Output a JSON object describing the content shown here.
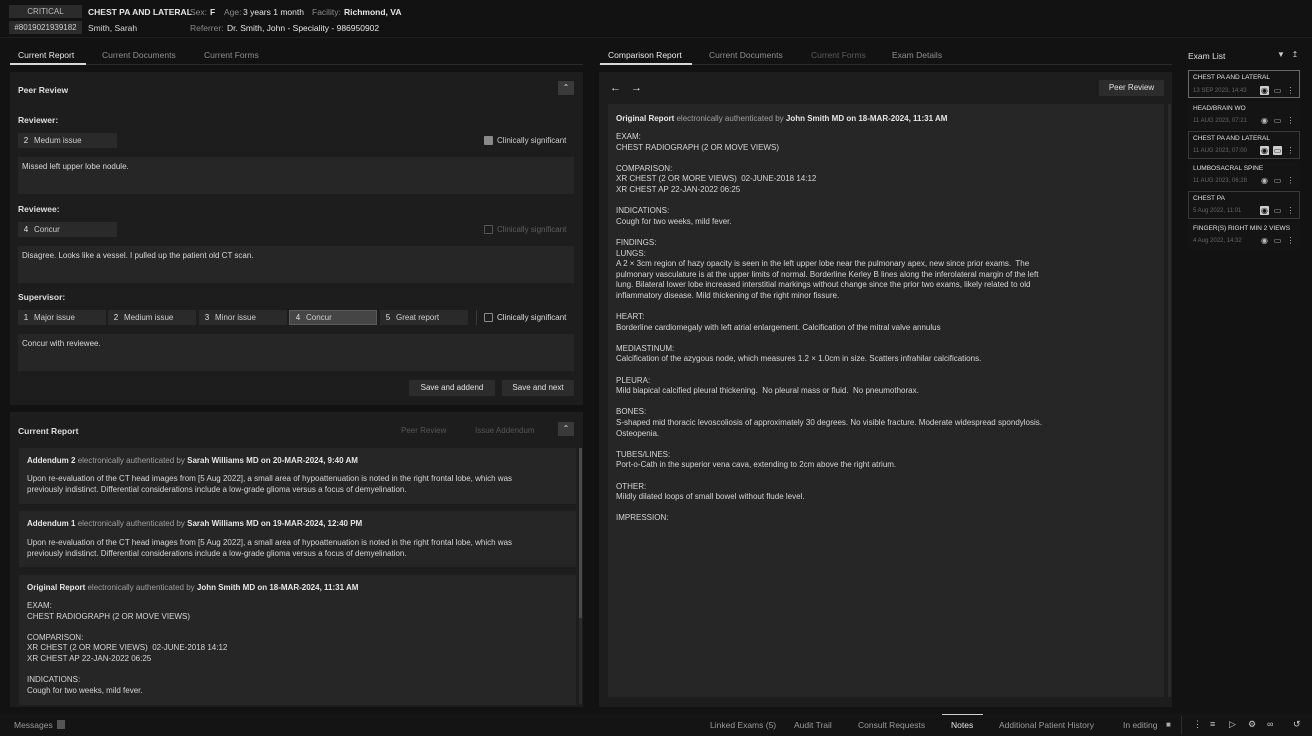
{
  "header": {
    "status": "CRITICAL",
    "exam_title": "CHEST PA AND LATERAL",
    "sex_label": "Sex:",
    "sex": "F",
    "age_label": "Age:",
    "age": "3 years 1 month",
    "facility_label": "Facility:",
    "facility": "Richmond, VA",
    "mrn": "#8019021939182",
    "patient_name": "Smith, Sarah",
    "referrer_label": "Referrer:",
    "referrer": "Dr. Smith, John - Speciality - 986950902"
  },
  "left_tabs": [
    "Current Report",
    "Current Documents",
    "Current Forms"
  ],
  "peer_review": {
    "title": "Peer Review",
    "collapse_icon": "chevron-up",
    "reviewer_label": "Reviewer:",
    "reviewer_score_num": "2",
    "reviewer_score": "Medum issue",
    "reviewer_sig_label": "Clinically significant",
    "reviewer_sig_checked": true,
    "reviewer_comment": "Missed left upper lobe nodule.",
    "reviewee_label": "Reviewee:",
    "reviewee_score_num": "4",
    "reviewee_score": "Concur",
    "reviewee_sig_label": "Clinically significant",
    "reviewee_comment": "Disagree. Looks like a vessel. I pulled up the patient old CT scan.",
    "supervisor_label": "Supervisor:",
    "options": [
      {
        "num": "1",
        "label": "Major issue"
      },
      {
        "num": "2",
        "label": "Medium issue"
      },
      {
        "num": "3",
        "label": "Minor issue"
      },
      {
        "num": "4",
        "label": "Concur"
      },
      {
        "num": "5",
        "label": "Great report"
      }
    ],
    "selected_option": "4",
    "supervisor_sig_label": "Clinically significant",
    "supervisor_comment": "Concur with reviewee.",
    "save_addend": "Save and addend",
    "save_next": "Save and next"
  },
  "current_report": {
    "title": "Current Report",
    "peer_review_btn": "Peer Review",
    "issue_addendum_btn": "Issue Addendum",
    "addenda": [
      {
        "title": "Addendum 2",
        "auth_text": "electronically authenticated by",
        "author_date": "Sarah Williams MD on 20-MAR-2024, 9:40 AM",
        "body": "Upon re-evaluation of the CT head images from [5 Aug 2022], a small area of hypoattenuation is noted in the right frontal lobe, which was\npreviously indistinct. Differential considerations include a low-grade glioma versus a focus of demyelination."
      },
      {
        "title": "Addendum 1",
        "auth_text": "electronically authenticated by",
        "author_date": "Sarah Williams MD on 19-MAR-2024, 12:40 PM",
        "body": "Upon re-evaluation of the CT head images from [5 Aug 2022], a small area of hypoattenuation is noted in the right frontal lobe, which was\npreviously indistinct. Differential considerations include a low-grade glioma versus a focus of demyelination."
      }
    ],
    "original_title": "Original Report",
    "original_auth_text": "electronically authenticated by",
    "original_author_date": "John Smith MD on 18-MAR-2024, 11:31 AM",
    "original_body": "EXAM:\nCHEST RADIOGRAPH (2 OR MOVE VIEWS)\n\nCOMPARISON:\nXR CHEST (2 OR MORE VIEWS)  02-JUNE-2018 14:12\nXR CHEST AP 22-JAN-2022 06:25\n\nINDICATIONS:\nCough for two weeks, mild fever."
  },
  "right_tabs": [
    "Comparison Report",
    "Current Documents",
    "Current Forms",
    "Exam Details"
  ],
  "comparison": {
    "peer_review_btn": "Peer Review",
    "original_title": "Original Report",
    "auth_text": "electronically authenticated by",
    "author_date": "John Smith MD on 18-MAR-2024, 11:31 AM",
    "body": "EXAM:\nCHEST RADIOGRAPH (2 OR MOVE VIEWS)\n\nCOMPARISON:\nXR CHEST (2 OR MORE VIEWS)  02-JUNE-2018 14:12\nXR CHEST AP 22-JAN-2022 06:25\n\nINDICATIONS:\nCough for two weeks, mild fever.\n\nFINDINGS:\nLUNGS:\nA 2 × 3cm region of hazy opacity is seen in the left upper lobe near the pulmonary apex, new since prior exams.  The\npulmonary vasculature is at the upper limits of normal. Borderline Kerley B lines along the inferolateral margin of the left\nlung. Bilateral lower lobe increased interstitial markings without change since the prior two exams, likely related to old\ninflammatory disease. Mild thickening of the right minor fissure.\n\nHEART:\nBorderline cardiomegaly with left atrial enlargement. Calcification of the mitral valve annulus\n\nMEDIASTINUM:\nCalcification of the azygous node, which measures 1.2 × 1.0cm in size. Scatters infrahilar calcifications.\n\nPLEURA:\nMild biapical calcified pleural thickening.  No pleural mass or fluid.  No pneumothorax.\n\nBONES:\nS-shaped mid thoracic levoscoliosis of approximately 30 degrees. No visible fracture. Moderate widespread spondylosis.\nOsteopenia.\n\nTUBES/LINES:\nPort-o-Cath in the superior vena cava, extending to 2cm above the right atrium.\n\nOTHER:\nMildly dilated loops of small bowel without flude level.\n\nIMPRESSION:"
  },
  "exam_list": {
    "title": "Exam List",
    "items": [
      {
        "name": "CHEST PA AND LATERAL",
        "date": "13 SEP 2023, 14:43"
      },
      {
        "name": "HEAD/BRAIN WO",
        "date": "11 AUG 2023, 07:21"
      },
      {
        "name": "CHEST PA AND LATERAL",
        "date": "11 AUG 2023, 07:00"
      },
      {
        "name": "LUMBOSACRAL SPINE",
        "date": "11 AUG 2023, 06:28"
      },
      {
        "name": "CHEST PA",
        "date": "5 Aug 2022, 11:01"
      },
      {
        "name": "FINGER(S) RIGHT MIN 2 VIEWS",
        "date": "4 Aug 2022, 14:32"
      }
    ]
  },
  "bottom_bar": {
    "messages": "Messages",
    "tabs": [
      "Linked Exams (5)",
      "Audit Trail",
      "Consult Requests",
      "Notes",
      "Additional Patient History"
    ],
    "in_editing": "In editing"
  }
}
